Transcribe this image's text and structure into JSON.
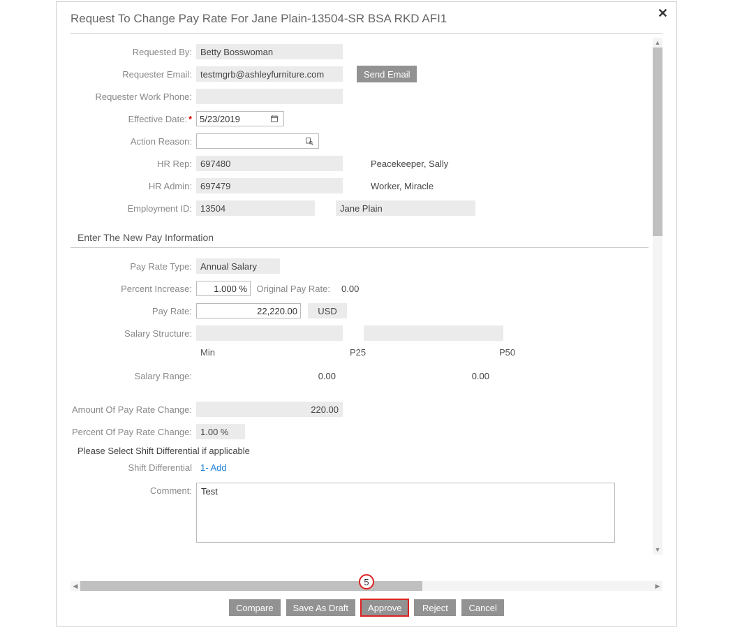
{
  "title": "Request To Change Pay Rate For Jane Plain-13504-SR BSA RKD AFI1",
  "fields": {
    "requested_by": {
      "label": "Requested By:",
      "value": "Betty Bosswoman"
    },
    "requester_email": {
      "label": "Requester Email:",
      "value": "testmgrb@ashleyfurniture.com"
    },
    "send_email_btn": "Send Email",
    "requester_work_phone": {
      "label": "Requester Work Phone:",
      "value": ""
    },
    "effective_date": {
      "label": "Effective Date:",
      "value": "5/23/2019"
    },
    "action_reason": {
      "label": "Action Reason:",
      "value": ""
    },
    "hr_rep": {
      "label": "HR Rep:",
      "value": "697480",
      "name": "Peacekeeper, Sally"
    },
    "hr_admin": {
      "label": "HR Admin:",
      "value": "697479",
      "name": "Worker, Miracle"
    },
    "employment_id": {
      "label": "Employment ID:",
      "value": "13504",
      "name": "Jane Plain"
    }
  },
  "section_pay_header": "Enter The New Pay Information",
  "pay": {
    "pay_rate_type": {
      "label": "Pay Rate Type:",
      "value": "Annual Salary"
    },
    "percent_increase": {
      "label": "Percent Increase:",
      "value": "1.000 %"
    },
    "original_pay_rate": {
      "label": "Original Pay Rate:",
      "value": "0.00"
    },
    "pay_rate": {
      "label": "Pay Rate:",
      "value": "22,220.00",
      "currency": "USD"
    },
    "salary_structure": {
      "label": "Salary Structure:",
      "value1": "",
      "value2": ""
    },
    "range_headers": {
      "min": "Min",
      "p25": "P25",
      "p50": "P50"
    },
    "salary_range": {
      "label": "Salary Range:",
      "v1": "0.00",
      "v2": "0.00"
    },
    "amount_change": {
      "label": "Amount Of Pay Rate Change:",
      "value": "220.00"
    },
    "percent_change": {
      "label": "Percent Of Pay Rate Change:",
      "value": "1.00 %"
    },
    "shift_note": "Please Select Shift Differential if applicable",
    "shift_diff": {
      "label": "Shift Differential",
      "link": "1- Add"
    },
    "comment": {
      "label": "Comment:",
      "value": "Test"
    }
  },
  "step_badge": "5",
  "footer": {
    "compare": "Compare",
    "save_draft": "Save As Draft",
    "approve": "Approve",
    "reject": "Reject",
    "cancel": "Cancel"
  }
}
